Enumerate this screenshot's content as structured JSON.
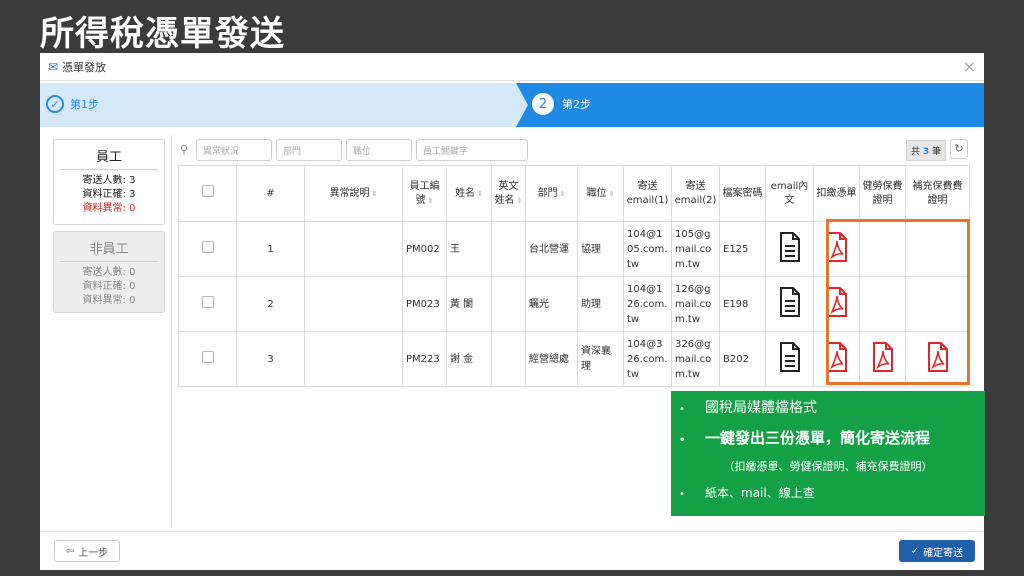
{
  "slide_title": "所得稅憑單發送",
  "dialog": {
    "title": "憑單發放",
    "close": "×"
  },
  "steps": [
    {
      "label": "第1步",
      "icon": "✓"
    },
    {
      "label": "第2步",
      "number": "2"
    }
  ],
  "employee_panel": {
    "title": "員工",
    "send_count": "寄送人數: 3",
    "ok_count": "資料正確: 3",
    "err_count": "資料異常: 0"
  },
  "nonemployee_panel": {
    "title": "非員工",
    "send_count": "寄送人數: 0",
    "ok_count": "資料正確: 0",
    "err_count": "資料異常: 0"
  },
  "filters": {
    "status_placeholder": "異常狀況",
    "dept_placeholder": "部門",
    "title_placeholder": "職位",
    "keyword_placeholder": "員工關鍵字"
  },
  "count": {
    "prefix": "共",
    "value": "3",
    "suffix": "筆"
  },
  "columns": [
    "#",
    "異常說明",
    "員工編號",
    "姓名",
    "英文姓名",
    "部門",
    "職位",
    "寄送email(1)",
    "寄送email(2)",
    "檔案密碼",
    "email內文",
    "扣繳憑單",
    "健勞保費證明",
    "補充保費費證明"
  ],
  "rows": [
    {
      "no": "1",
      "note": "",
      "id": "PM002",
      "name": "王",
      "en": "",
      "dept": "台北營運",
      "title": "協理",
      "email1": "104@105.com.tw",
      "email2": "105@gmail.com.tw",
      "pwd": "E125"
    },
    {
      "no": "2",
      "note": "",
      "id": "PM023",
      "name": "黃 闌",
      "en": "",
      "dept": "曬光",
      "title": "助理",
      "email1": "104@126.com.tw",
      "email2": "126@gmail.com.tw",
      "pwd": "E198"
    },
    {
      "no": "3",
      "note": "",
      "id": "PM223",
      "name": "謝 金",
      "en": "",
      "dept": "經營總處",
      "title": "資深襄理",
      "email1": "104@326.com.tw",
      "email2": "326@gmail.com.tw",
      "pwd": "B202"
    }
  ],
  "notes": {
    "line1": "國稅局媒體檔格式",
    "line2": "一鍵發出三份憑單，簡化寄送流程",
    "line3": "（扣繳憑單、勞健保證明、補充保費證明）",
    "line4": "紙本、mail、線上查"
  },
  "buttons": {
    "prev": "上一步",
    "confirm": "確定寄送"
  },
  "colors": {
    "accent": "#1d8ae5",
    "step_bg": "#d3e8f8",
    "highlight": "#e8742c",
    "green": "#14a146",
    "error": "#e02020",
    "pdf": "#e0262b"
  }
}
